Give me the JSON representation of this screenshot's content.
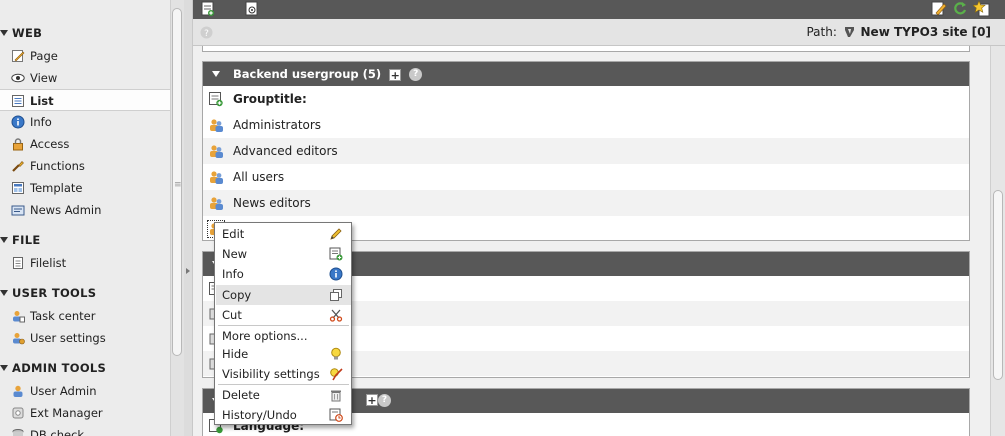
{
  "sidebar": {
    "groups": [
      {
        "title": "WEB",
        "items": [
          {
            "label": "Page",
            "icon": "page-icon"
          },
          {
            "label": "View",
            "icon": "view-icon"
          },
          {
            "label": "List",
            "icon": "list-icon",
            "active": true
          },
          {
            "label": "Info",
            "icon": "info-icon"
          },
          {
            "label": "Access",
            "icon": "access-icon"
          },
          {
            "label": "Functions",
            "icon": "functions-icon"
          },
          {
            "label": "Template",
            "icon": "template-icon"
          },
          {
            "label": "News Admin",
            "icon": "news-admin-icon"
          }
        ]
      },
      {
        "title": "FILE",
        "items": [
          {
            "label": "Filelist",
            "icon": "filelist-icon"
          }
        ]
      },
      {
        "title": "USER TOOLS",
        "items": [
          {
            "label": "Task center",
            "icon": "task-center-icon"
          },
          {
            "label": "User settings",
            "icon": "user-settings-icon"
          }
        ]
      },
      {
        "title": "ADMIN TOOLS",
        "items": [
          {
            "label": "User Admin",
            "icon": "user-admin-icon"
          },
          {
            "label": "Ext Manager",
            "icon": "ext-manager-icon"
          },
          {
            "label": "DB check",
            "icon": "db-check-icon"
          }
        ]
      }
    ]
  },
  "docheader": {
    "path_label": "Path:",
    "path_value": "New TYPO3 site [0]"
  },
  "panel": {
    "title": "Backend usergroup (5)",
    "column_header": "Grouptitle:",
    "rows": [
      "Administrators",
      "Advanced editors",
      "All users",
      "News editors"
    ]
  },
  "panel2": {
    "column_header": "Language:"
  },
  "context_menu": {
    "items": [
      {
        "label": "Edit",
        "icon": "pencil-icon"
      },
      {
        "label": "New",
        "icon": "new-record-icon"
      },
      {
        "label": "Info",
        "icon": "info-icon"
      },
      {
        "label": "Copy",
        "icon": "copy-icon",
        "highlighted": true
      },
      {
        "label": "Cut",
        "icon": "scissors-icon"
      },
      {
        "label": "More options...",
        "icon": ""
      },
      {
        "label": "Hide",
        "icon": "lightbulb-icon"
      },
      {
        "label": "Visibility settings",
        "icon": "visibility-icon"
      },
      {
        "label": "Delete",
        "icon": "trash-icon"
      },
      {
        "label": "History/Undo",
        "icon": "history-icon"
      }
    ]
  },
  "colors": {
    "header_bar": "#585858",
    "accent_orange": "#e8a33a",
    "info_blue": "#3a78c8"
  }
}
